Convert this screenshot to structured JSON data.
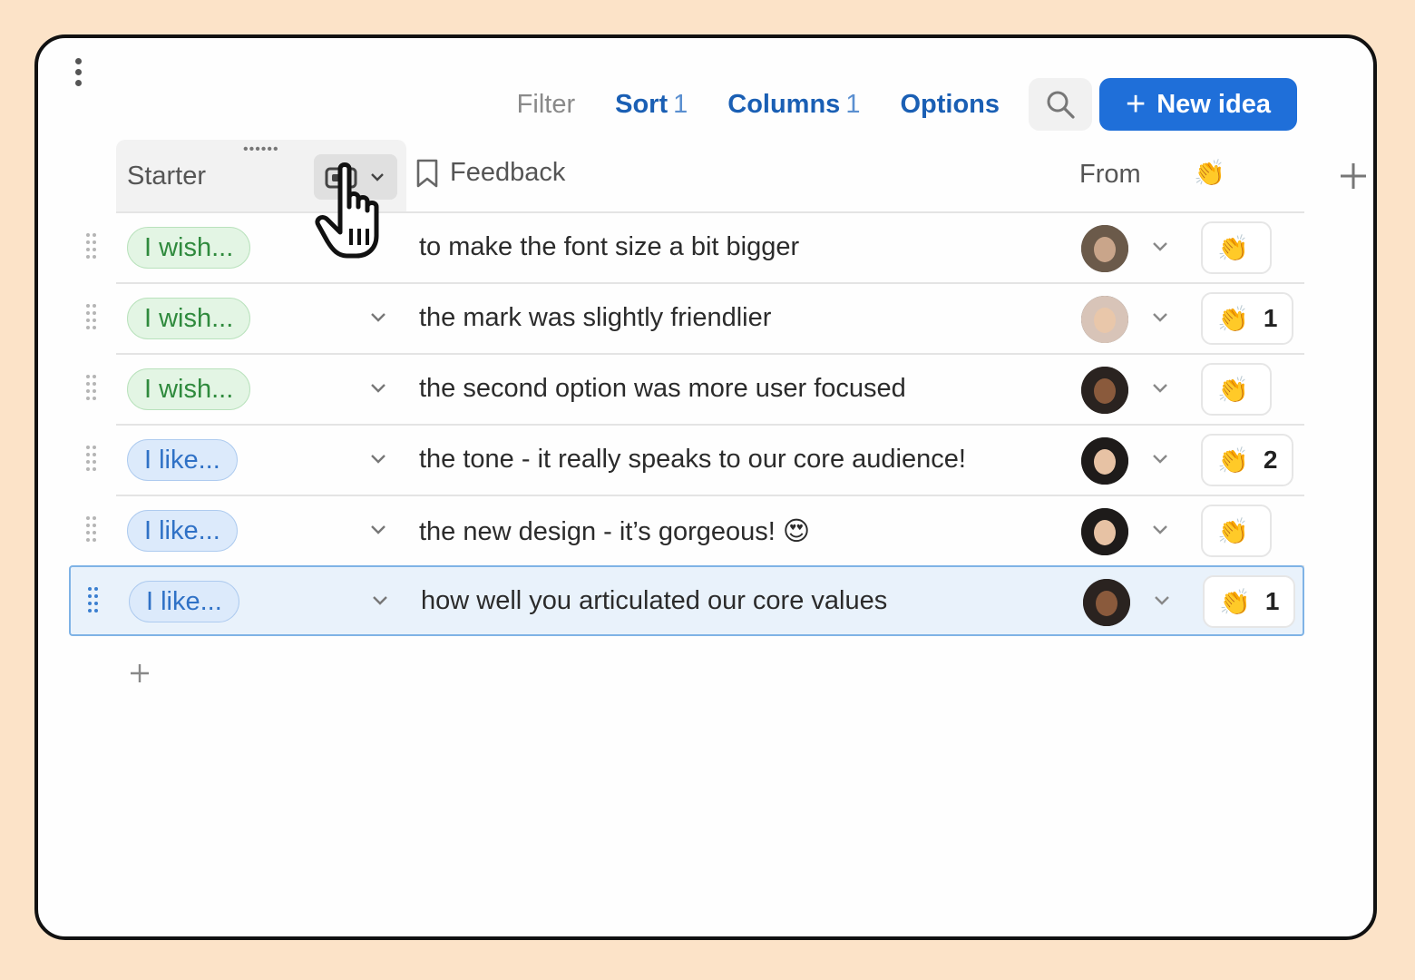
{
  "toolbar": {
    "filter": "Filter",
    "sort": "Sort",
    "sort_count": "1",
    "columns": "Columns",
    "columns_count": "1",
    "options": "Options",
    "new_idea": "New idea"
  },
  "header": {
    "starter": "Starter",
    "feedback": "Feedback",
    "from": "From",
    "clap": "👏"
  },
  "rows": [
    {
      "starter": "I wish...",
      "type": "wish",
      "feedback": "to make the font size a bit bigger",
      "avatar": "avatar-man-beard",
      "claps": ""
    },
    {
      "starter": "I wish...",
      "type": "wish",
      "feedback": "the mark was slightly friendlier",
      "avatar": "avatar-woman-light",
      "claps": "1"
    },
    {
      "starter": "I wish...",
      "type": "wish",
      "feedback": "the second option was more user focused",
      "avatar": "avatar-woman-curly",
      "claps": ""
    },
    {
      "starter": "I like...",
      "type": "like",
      "feedback": "the tone - it really speaks to our core audience!",
      "avatar": "avatar-woman-dark-hair",
      "claps": "2"
    },
    {
      "starter": "I like...",
      "type": "like",
      "feedback": "the new design - it’s gorgeous! 😍",
      "avatar": "avatar-woman-dark-hair",
      "claps": ""
    },
    {
      "starter": "I like...",
      "type": "like",
      "feedback": "how well you articulated our core values",
      "avatar": "avatar-woman-curly",
      "claps": "1",
      "selected": true
    }
  ],
  "colors": {
    "accent": "#1f6fd9",
    "wish_text": "#2f8a3d",
    "like_text": "#2f71c6",
    "background": "#fce3c8"
  },
  "icons": [
    "kebab-menu-icon",
    "search-icon",
    "plus-icon",
    "column-type-icon",
    "chevron-down-icon",
    "bookmark-icon",
    "clap-icon",
    "drag-handle-icon",
    "pointer-hand-icon"
  ]
}
